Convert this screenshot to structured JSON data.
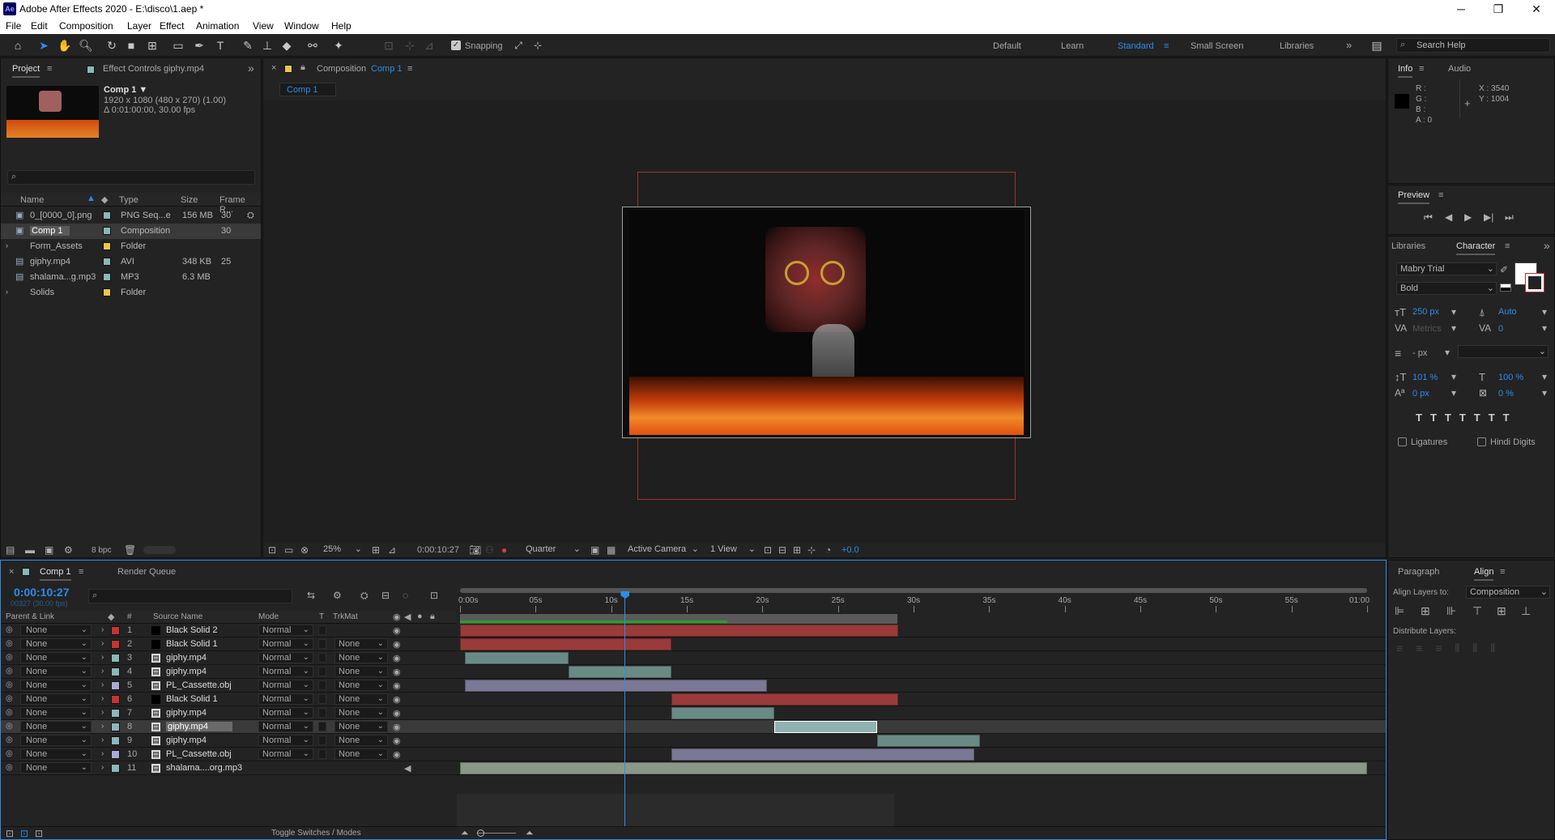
{
  "app": {
    "title": "Adobe After Effects 2020 - E:\\disco\\1.aep *",
    "logo": "Ae"
  },
  "window_controls": {
    "minimize": "─",
    "maximize": "❐",
    "close": "✕"
  },
  "menu": [
    "File",
    "Edit",
    "Composition",
    "Layer",
    "Effect",
    "Animation",
    "View",
    "Window",
    "Help"
  ],
  "toolbar": {
    "snapping": "Snapping",
    "workspaces": [
      "Default",
      "Learn",
      "Standard",
      "Small Screen",
      "Libraries"
    ],
    "active_workspace": "Standard",
    "search_placeholder": "Search Help"
  },
  "project_panel": {
    "tab_project": "Project",
    "tab_effects": "Effect Controls giphy.mp4",
    "comp_name": "Comp 1 ▼",
    "comp_info1": "1920 x 1080  (480 x 270) (1.00)",
    "comp_info2": "Δ 0:01:00:00, 30.00 fps",
    "columns": [
      "Name",
      "Type",
      "Size",
      "Frame R..."
    ],
    "items": [
      {
        "name": "0_[0000_0].png",
        "type": "PNG Seq...e",
        "size": "156 MB",
        "fr": "30",
        "color": "#8ab7b7",
        "icon": "seq"
      },
      {
        "name": "Comp 1",
        "type": "Composition",
        "size": "",
        "fr": "30",
        "color": "#8ab7b7",
        "icon": "comp"
      },
      {
        "name": "Form_Assets",
        "type": "Folder",
        "size": "",
        "fr": "",
        "color": "#e6c84a",
        "icon": "folder"
      },
      {
        "name": "giphy.mp4",
        "type": "AVI",
        "size": "348 KB",
        "fr": "25",
        "color": "#8ab7b7",
        "icon": "file"
      },
      {
        "name": "shalama...g.mp3",
        "type": "MP3",
        "size": "6.3 MB",
        "fr": "",
        "color": "#8ab7b7",
        "icon": "file"
      },
      {
        "name": "Solids",
        "type": "Folder",
        "size": "",
        "fr": "",
        "color": "#e6c84a",
        "icon": "folder"
      }
    ],
    "bpc": "8 bpc"
  },
  "comp_panel": {
    "tab": "Composition",
    "tab_name": "Comp 1",
    "sub_tab": "Comp 1",
    "zoom": "25%",
    "timecode": "0:00:10:27",
    "resolution": "Quarter",
    "camera": "Active Camera",
    "views": "1 View",
    "exposure": "+0.0"
  },
  "info_panel": {
    "tab": "Info",
    "tab2": "Audio",
    "r": "R :",
    "g": "G :",
    "b": "B :",
    "a": "A :  0",
    "x": "X : 3540",
    "y": "Y : 1004"
  },
  "preview_panel": {
    "title": "Preview"
  },
  "character_panel": {
    "tab1": "Libraries",
    "tab2": "Character",
    "font": "Mabry Trial",
    "style": "Bold",
    "size": "250 px",
    "leading": "Auto",
    "kerning": "Metrics",
    "tracking": "0",
    "stroke": "- px",
    "vscale": "101 %",
    "hscale": "100 %",
    "baseline": "0 px",
    "tsume": "0 %",
    "ligatures": "Ligatures",
    "hindi": "Hindi Digits"
  },
  "align_panel": {
    "tab1": "Paragraph",
    "tab2": "Align",
    "align_to_label": "Align Layers to:",
    "align_to": "Composition",
    "distribute": "Distribute Layers:"
  },
  "timeline": {
    "tab": "Comp 1",
    "tab2": "Render Queue",
    "timecode": "0:00:10:27",
    "frames": "00327 (30.00 fps)",
    "col_parent": "Parent & Link",
    "col_source": "Source Name",
    "col_mode": "Mode",
    "col_t": "T",
    "col_trkmat": "TrkMat",
    "ruler": [
      "0:00s",
      "05s",
      "10s",
      "15s",
      "20s",
      "25s",
      "30s",
      "35s",
      "40s",
      "45s",
      "50s",
      "55s",
      "01:00"
    ],
    "toggle": "Toggle Switches / Modes",
    "layers": [
      {
        "num": "1",
        "name": "Black Solid 2",
        "color": "#c83232",
        "mode": "Normal",
        "trk": "",
        "parent": "None",
        "src": "solid",
        "bar_start": 0,
        "bar_end": 29,
        "bar_color": "#9a3a3a"
      },
      {
        "num": "2",
        "name": "Black Solid 1",
        "color": "#c83232",
        "mode": "Normal",
        "trk": "None",
        "parent": "None",
        "src": "solid",
        "bar_start": 0,
        "bar_end": 14,
        "bar_color": "#9a3a3a"
      },
      {
        "num": "3",
        "name": "giphy.mp4",
        "color": "#8ab7b7",
        "mode": "Normal",
        "trk": "None",
        "parent": "None",
        "src": "file",
        "bar_start": 0.3,
        "bar_end": 7.2,
        "bar_color": "#6a8a86"
      },
      {
        "num": "4",
        "name": "giphy.mp4",
        "color": "#8ab7b7",
        "mode": "Normal",
        "trk": "None",
        "parent": "None",
        "src": "file",
        "bar_start": 7.2,
        "bar_end": 14,
        "bar_color": "#6a8a86"
      },
      {
        "num": "5",
        "name": "PL_Cassette.obj",
        "color": "#a9a9d9",
        "mode": "Normal",
        "trk": "None",
        "parent": "None",
        "src": "file",
        "bar_start": 0.3,
        "bar_end": 20.3,
        "bar_color": "#7a7895"
      },
      {
        "num": "6",
        "name": "Black Solid 1",
        "color": "#c83232",
        "mode": "Normal",
        "trk": "None",
        "parent": "None",
        "src": "solid",
        "bar_start": 14,
        "bar_end": 29,
        "bar_color": "#9a3a3a"
      },
      {
        "num": "7",
        "name": "giphy.mp4",
        "color": "#8ab7b7",
        "mode": "Normal",
        "trk": "None",
        "parent": "None",
        "src": "file",
        "bar_start": 14,
        "bar_end": 20.8,
        "bar_color": "#6a8a86"
      },
      {
        "num": "8",
        "name": "giphy.mp4",
        "color": "#8ab7b7",
        "mode": "Normal",
        "trk": "None",
        "parent": "None",
        "src": "file",
        "bar_start": 20.8,
        "bar_end": 27.6,
        "bar_color": "#8fb3b0",
        "selected": true
      },
      {
        "num": "9",
        "name": "giphy.mp4",
        "color": "#8ab7b7",
        "mode": "Normal",
        "trk": "None",
        "parent": "None",
        "src": "file",
        "bar_start": 27.6,
        "bar_end": 34.4,
        "bar_color": "#6a8a86"
      },
      {
        "num": "10",
        "name": "PL_Cassette.obj",
        "color": "#a9a9d9",
        "mode": "Normal",
        "trk": "None",
        "parent": "None",
        "src": "file",
        "bar_start": 14,
        "bar_end": 34,
        "bar_color": "#7a7895"
      },
      {
        "num": "11",
        "name": "shalama....org.mp3",
        "color": "#8ab7b7",
        "mode": "",
        "trk": "",
        "parent": "None",
        "src": "file",
        "bar_start": 0,
        "bar_end": 60,
        "bar_color": "#8a9888"
      }
    ]
  }
}
